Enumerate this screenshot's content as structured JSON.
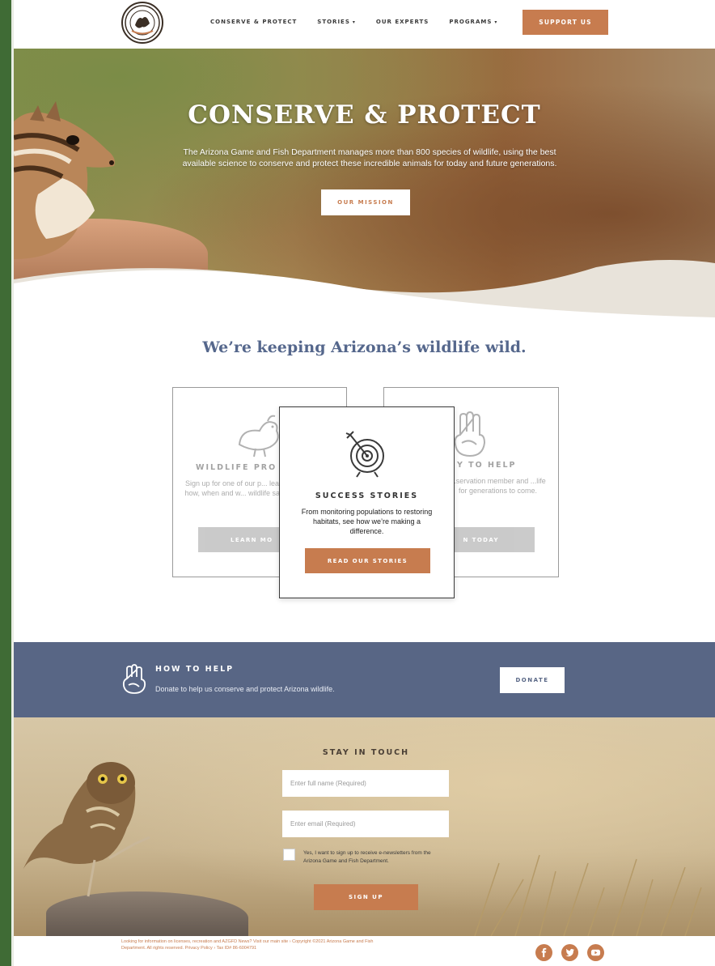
{
  "header": {
    "logo_text": "ARIZONA GAME & FISH",
    "nav": [
      {
        "label": "CONSERVE & PROTECT",
        "has_dropdown": false
      },
      {
        "label": "STORIES",
        "has_dropdown": true
      },
      {
        "label": "OUR EXPERTS",
        "has_dropdown": false
      },
      {
        "label": "PROGRAMS",
        "has_dropdown": true
      }
    ],
    "support_label": "SUPPORT US"
  },
  "hero": {
    "title": "CONSERVE & PROTECT",
    "description": "The Arizona Game and Fish Department manages more than 800 species of wildlife, using the best available science to conserve and protect these incredible animals for today and future generations.",
    "button_label": "OUR MISSION"
  },
  "intro": {
    "title": "We’re keeping Arizona’s wildlife wild."
  },
  "cards": {
    "left": {
      "title": "WILDLIFE PRO",
      "text": "Sign up for one of our p... learn how, when and w... wildlife safe",
      "button_label": "LEARN MO"
    },
    "center": {
      "title": "SUCCESS STORIES",
      "text": "From monitoring populations to restoring habitats, see how we’re making a difference.",
      "button_label": "READ OUR STORIES"
    },
    "right": {
      "title": "Y TO HELP",
      "text": "...servation member and ...life for generations to come.",
      "button_label": "N TODAY"
    }
  },
  "help_band": {
    "title": "HOW TO HELP",
    "text": "Donate to help us conserve and protect Arizona wildlife.",
    "button_label": "DONATE"
  },
  "signup": {
    "title": "STAY IN TOUCH",
    "name_placeholder": "Enter full name (Required)",
    "email_placeholder": "Enter email (Required)",
    "consent_text": "Yes, I want to sign up to receive e-newsletters from the Arizona Game and Fish Department.",
    "button_label": "SIGN UP"
  },
  "footer": {
    "text": "Looking for information on licenses, recreation and AZGFD News? Visit our main site › Copyright ©2021 Arizona Game and Fish Department. All rights reserved. Privacy Policy › Tax ID# 86-6004791",
    "social": [
      "facebook-icon",
      "twitter-icon",
      "youtube-icon"
    ]
  },
  "colors": {
    "accent": "#c77c4f",
    "band": "#586685",
    "headline": "#55678c",
    "rail": "#3f6b35"
  }
}
